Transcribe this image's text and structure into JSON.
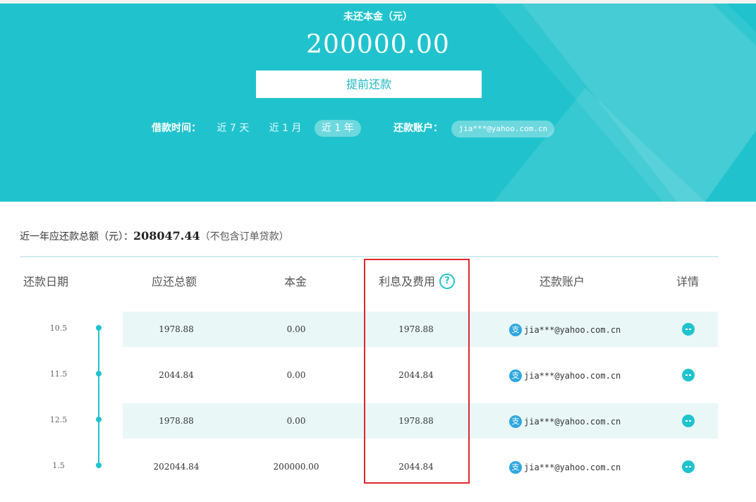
{
  "colors": {
    "accent": "#20c3cd",
    "row_shade": "#e9f7f7",
    "highlight": "#e0262e",
    "alipay": "#2fa8e0"
  },
  "header": {
    "title": "未还本金（元）",
    "amount": "200000.00",
    "prepay_button": "提前还款",
    "period_label": "借款时间：",
    "periods": [
      "近 7 天",
      "近 1 月",
      "近 1 年"
    ],
    "active_period": "近 1 年",
    "account_label": "还款账户：",
    "account_value": "jia***@yahoo.com.cn"
  },
  "summary": {
    "label": "近一年应还款总额（元）：",
    "amount": "208047.44",
    "note": "（不包含订单贷款）"
  },
  "table": {
    "headers": {
      "date": "还款日期",
      "total": "应还总额",
      "principal": "本金",
      "interest": "利息及费用",
      "account": "还款账户",
      "detail": "详情"
    },
    "help_icon": "question-icon",
    "account_icon": "alipay-icon",
    "detail_icon": "more-dots-icon",
    "rows": [
      {
        "date": "10.5",
        "total": "1978.88",
        "principal": "0.00",
        "interest": "1978.88",
        "account_glyph": "支",
        "account": "jia***@yahoo.com.cn"
      },
      {
        "date": "11.5",
        "total": "2044.84",
        "principal": "0.00",
        "interest": "2044.84",
        "account_glyph": "支",
        "account": "jia***@yahoo.com.cn"
      },
      {
        "date": "12.5",
        "total": "1978.88",
        "principal": "0.00",
        "interest": "1978.88",
        "account_glyph": "支",
        "account": "jia***@yahoo.com.cn"
      },
      {
        "date": "1.5",
        "total": "202044.84",
        "principal": "200000.00",
        "interest": "2044.84",
        "account_glyph": "支",
        "account": "jia***@yahoo.com.cn"
      }
    ]
  }
}
